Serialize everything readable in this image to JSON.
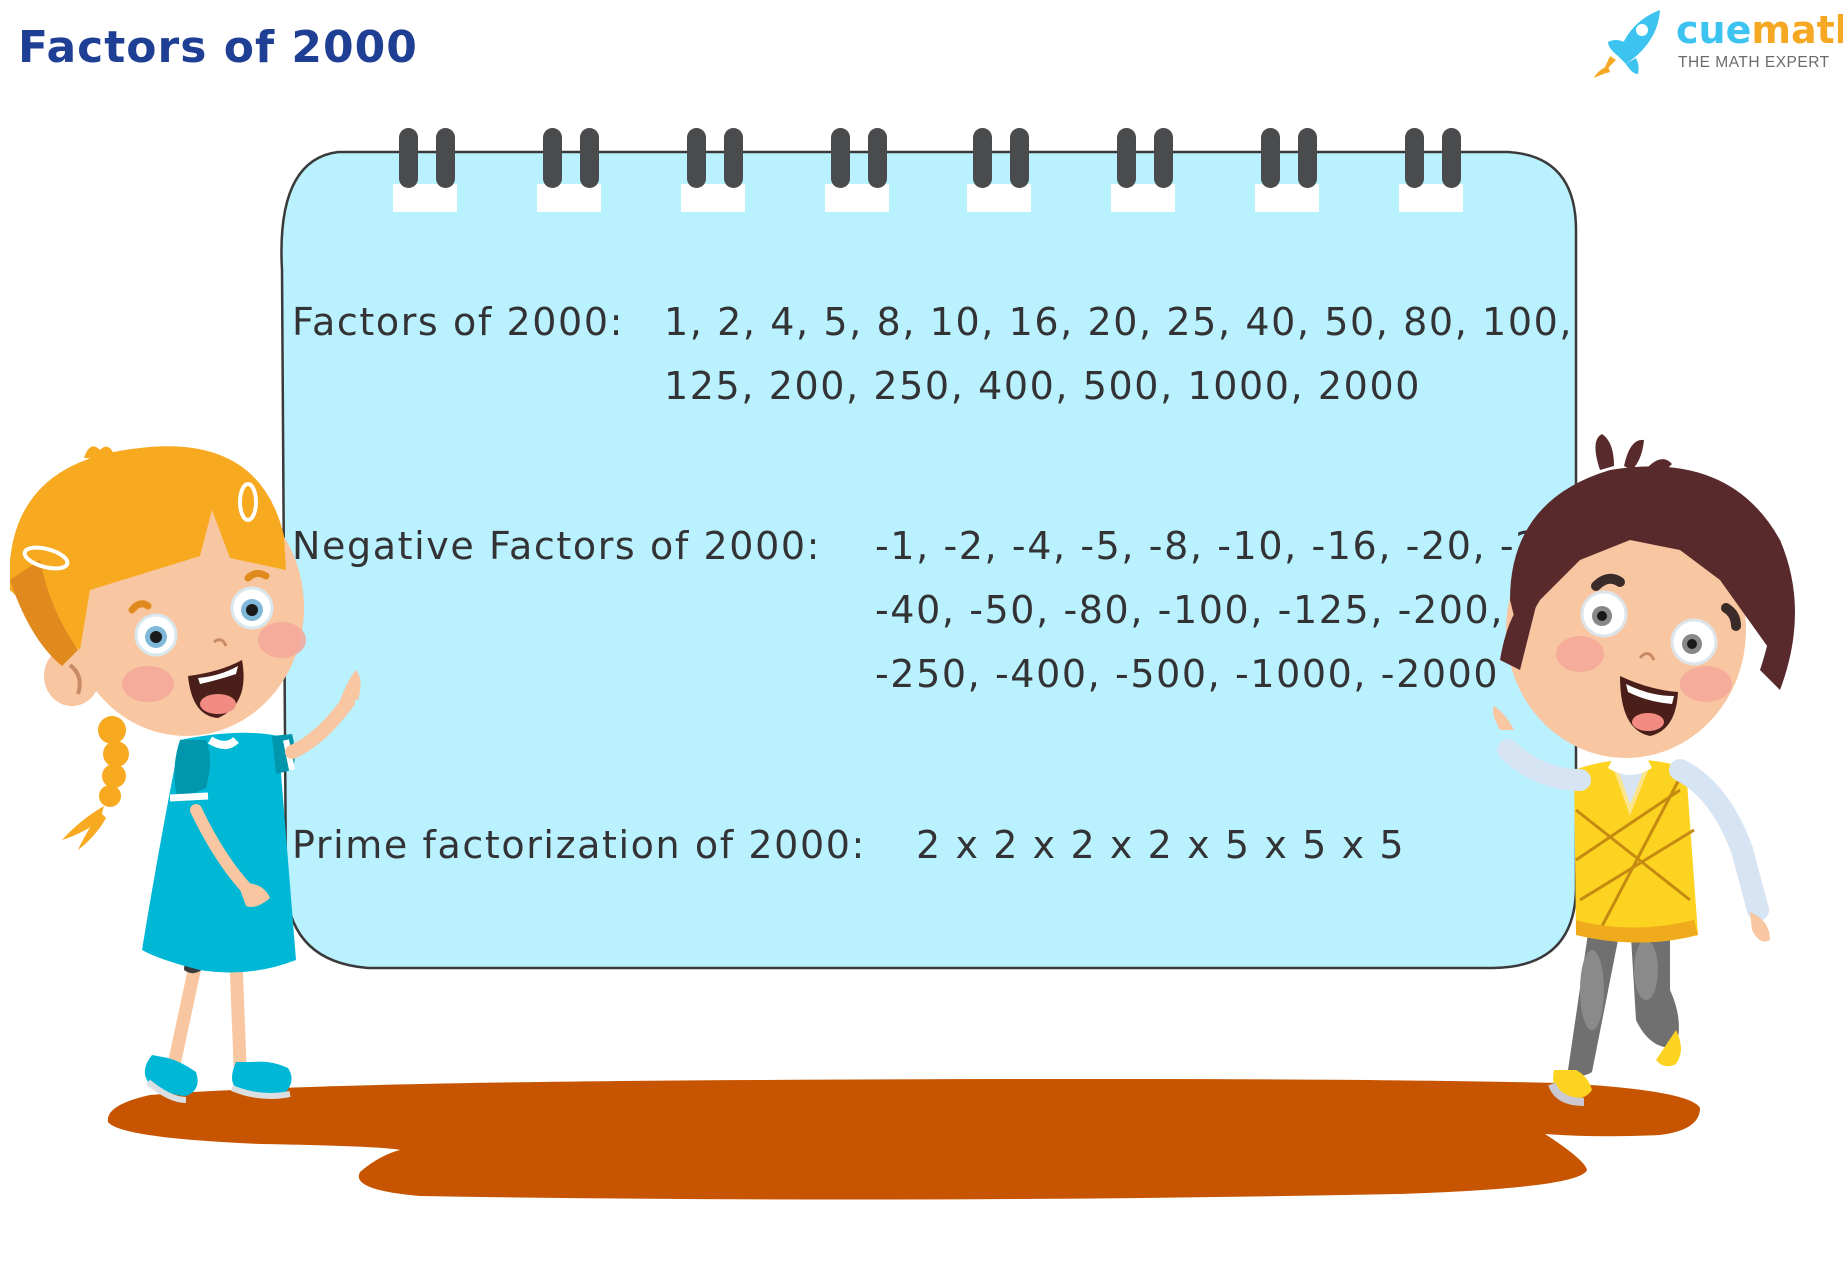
{
  "header": {
    "title": "Factors of 2000"
  },
  "logo": {
    "brand_part1": "cue",
    "brand_part2": "math",
    "tagline": "THE MATH EXPERT",
    "icon": "rocket-icon",
    "colors": {
      "cue": "#3cc3f0",
      "math": "#f7a823",
      "tagline": "#6b6b6b"
    }
  },
  "board": {
    "background": "#b9f1ff",
    "ring_count": 8,
    "factors": {
      "label": "Factors of 2000:",
      "lines": [
        "1, 2, 4, 5, 8, 10, 16, 20, 25, 40, 50, 80, 100,",
        "125, 200, 250, 400, 500, 1000, 2000"
      ],
      "values": [
        1,
        2,
        4,
        5,
        8,
        10,
        16,
        20,
        25,
        40,
        50,
        80,
        100,
        125,
        200,
        250,
        400,
        500,
        1000,
        2000
      ]
    },
    "negative_factors": {
      "label": "Negative Factors of 2000:",
      "lines": [
        "-1, -2, -4, -5, -8, -10, -16, -20, -25,",
        "-40, -50, -80, -100, -125, -200,",
        "-250, -400, -500, -1000, -2000"
      ],
      "values": [
        -1,
        -2,
        -4,
        -5,
        -8,
        -10,
        -16,
        -20,
        -25,
        -40,
        -50,
        -80,
        -100,
        -125,
        -200,
        -250,
        -400,
        -500,
        -1000,
        -2000
      ]
    },
    "prime_factorization": {
      "label": "Prime factorization of 2000:",
      "expression": "2 x 2 x 2 x 2 x 5 x 5 x 5",
      "factors": [
        2,
        2,
        2,
        2,
        5,
        5,
        5
      ]
    }
  },
  "illustration": {
    "left_character": "girl-character",
    "right_character": "boy-character",
    "ground": "ground-shadow",
    "colors": {
      "shadow": "#c65400",
      "girl_dress": "#00b8d6",
      "girl_hair": "#f7a920",
      "boy_hair": "#582a2b",
      "boy_vest": "#fdd321"
    }
  }
}
